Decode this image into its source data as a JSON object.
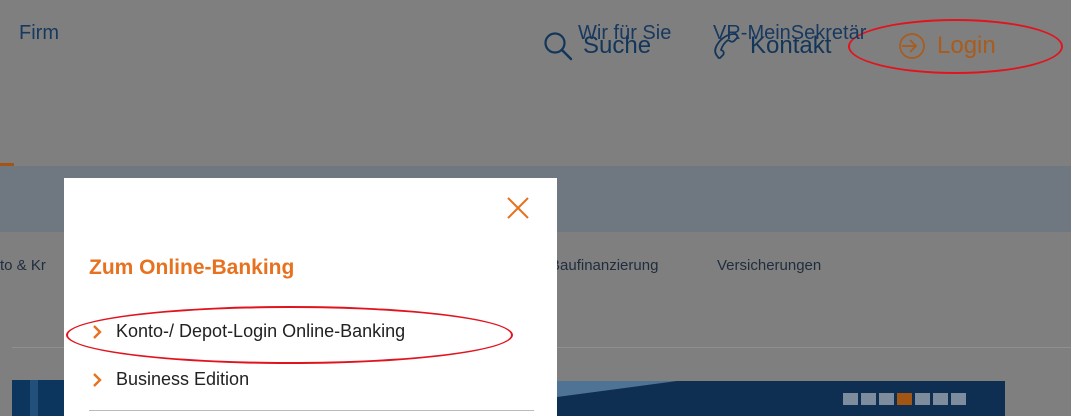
{
  "header": {
    "search_label": "Suche",
    "contact_label": "Kontakt",
    "login_label": "Login"
  },
  "mainnav": {
    "items": [
      "Firm",
      "Wir für Sie",
      "VR-MeinSekretär"
    ]
  },
  "subnav": {
    "items": [
      "to & Kr",
      "Baufinanzierung",
      "Versicherungen"
    ]
  },
  "popup": {
    "title": "Zum Online-Banking",
    "links": [
      "Konto-/ Depot-Login Online-Banking",
      "Business Edition"
    ]
  },
  "colors": {
    "accent_orange": "#e8711f",
    "navy": "#12365a",
    "annotation_red": "#e1141e"
  },
  "icons": [
    "search-icon",
    "phone-icon",
    "login-icon",
    "close-icon",
    "chevron-right-icon"
  ]
}
